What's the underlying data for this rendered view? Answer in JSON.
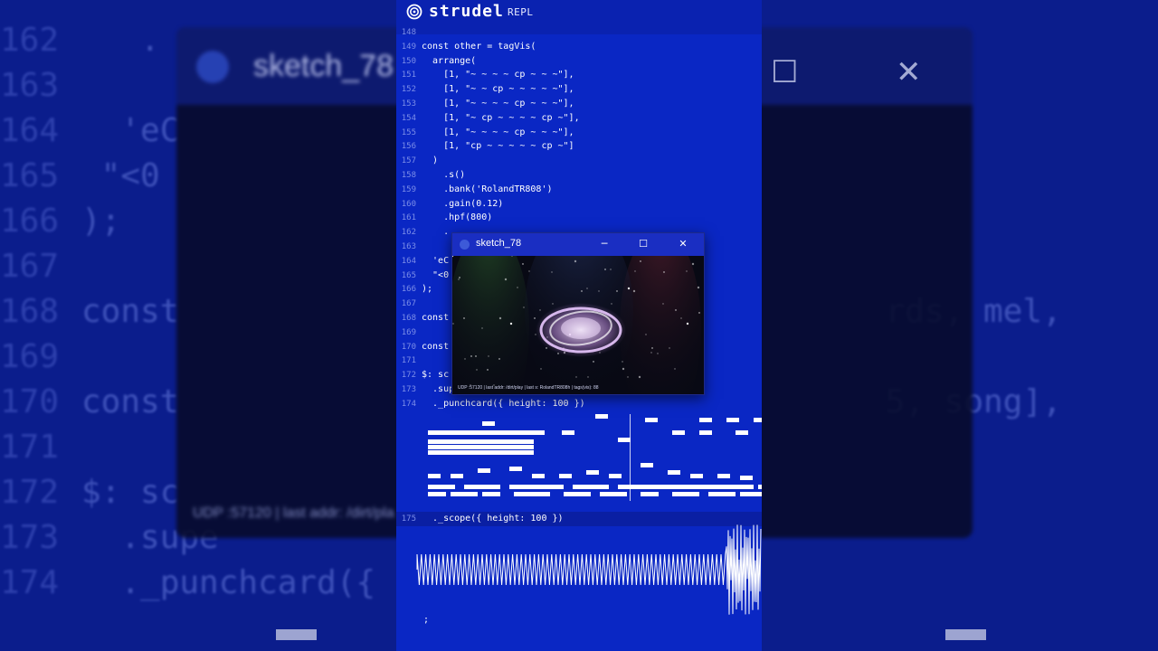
{
  "app": {
    "name": "strudel",
    "subtitle": "REPL"
  },
  "editor": {
    "lines": [
      {
        "n": "148",
        "text": ""
      },
      {
        "n": "149",
        "text": "const other = tagVis("
      },
      {
        "n": "150",
        "text": "  arrange("
      },
      {
        "n": "151",
        "text": "    [1, \"~ ~ ~ ~ cp ~ ~ ~\"],"
      },
      {
        "n": "152",
        "text": "    [1, \"~ ~ cp ~ ~ ~ ~ ~\"],"
      },
      {
        "n": "153",
        "text": "    [1, \"~ ~ ~ ~ cp ~ ~ ~\"],"
      },
      {
        "n": "154",
        "text": "    [1, \"~ cp ~ ~ ~ ~ cp ~\"],"
      },
      {
        "n": "155",
        "text": "    [1, \"~ ~ ~ ~ cp ~ ~ ~\"],"
      },
      {
        "n": "156",
        "text": "    [1, \"cp ~ ~ ~ ~ ~ cp ~\"]"
      },
      {
        "n": "157",
        "text": "  )"
      },
      {
        "n": "158",
        "text": "    .s()"
      },
      {
        "n": "159",
        "text": "    .bank('RolandTR808')"
      },
      {
        "n": "160",
        "text": "    .gain(0.12)"
      },
      {
        "n": "161",
        "text": "    .hpf(800)"
      },
      {
        "n": "162",
        "text": "    ."
      },
      {
        "n": "163",
        "text": ""
      },
      {
        "n": "164",
        "text": "  'eC"
      },
      {
        "n": "165",
        "text": "  \"<0"
      },
      {
        "n": "166",
        "text": ");"
      },
      {
        "n": "167",
        "text": ""
      },
      {
        "n": "168",
        "text": "const                                   rds, mel,"
      },
      {
        "n": "169",
        "text": ""
      },
      {
        "n": "170",
        "text": "const                                   5, song],"
      },
      {
        "n": "171",
        "text": ""
      },
      {
        "n": "172",
        "text": "$: sc"
      },
      {
        "n": "173",
        "text": "  .supe"
      },
      {
        "n": "174",
        "text": "  ._punchcard({ height: 100 })"
      }
    ],
    "line_175": {
      "n": "175",
      "text": "  ._scope({ height: 100 })"
    },
    "last_line": ";"
  },
  "window": {
    "title": "sketch_78",
    "minimize": "─",
    "maximize": "☐",
    "close": "✕",
    "status": "UDP :57120 | last addr: /dirt/play | last s: RolandTR808h | tags(vis): 88"
  },
  "background": {
    "title": "sketch_78",
    "status": "UDP :57120 | last addr: /dirt/pla",
    "lines": [
      {
        "n": "162",
        "text": "   ."
      },
      {
        "n": "163",
        "text": ""
      },
      {
        "n": "164",
        "text": "  'eC"
      },
      {
        "n": "165",
        "text": " \"<0"
      },
      {
        "n": "166",
        "text": ");"
      },
      {
        "n": "167",
        "text": ""
      },
      {
        "n": "168",
        "text": "const                                    rds, mel,"
      },
      {
        "n": "169",
        "text": ""
      },
      {
        "n": "170",
        "text": "const                                    5, song],"
      },
      {
        "n": "171",
        "text": ""
      },
      {
        "n": "172",
        "text": "$: sc"
      },
      {
        "n": "173",
        "text": "  .supe"
      },
      {
        "n": "174",
        "text": "  ._punchcard({ "
      }
    ]
  },
  "colors": {
    "panel": "#0a27c4",
    "accent": "#ffffff",
    "window": "#1a2ec2"
  }
}
